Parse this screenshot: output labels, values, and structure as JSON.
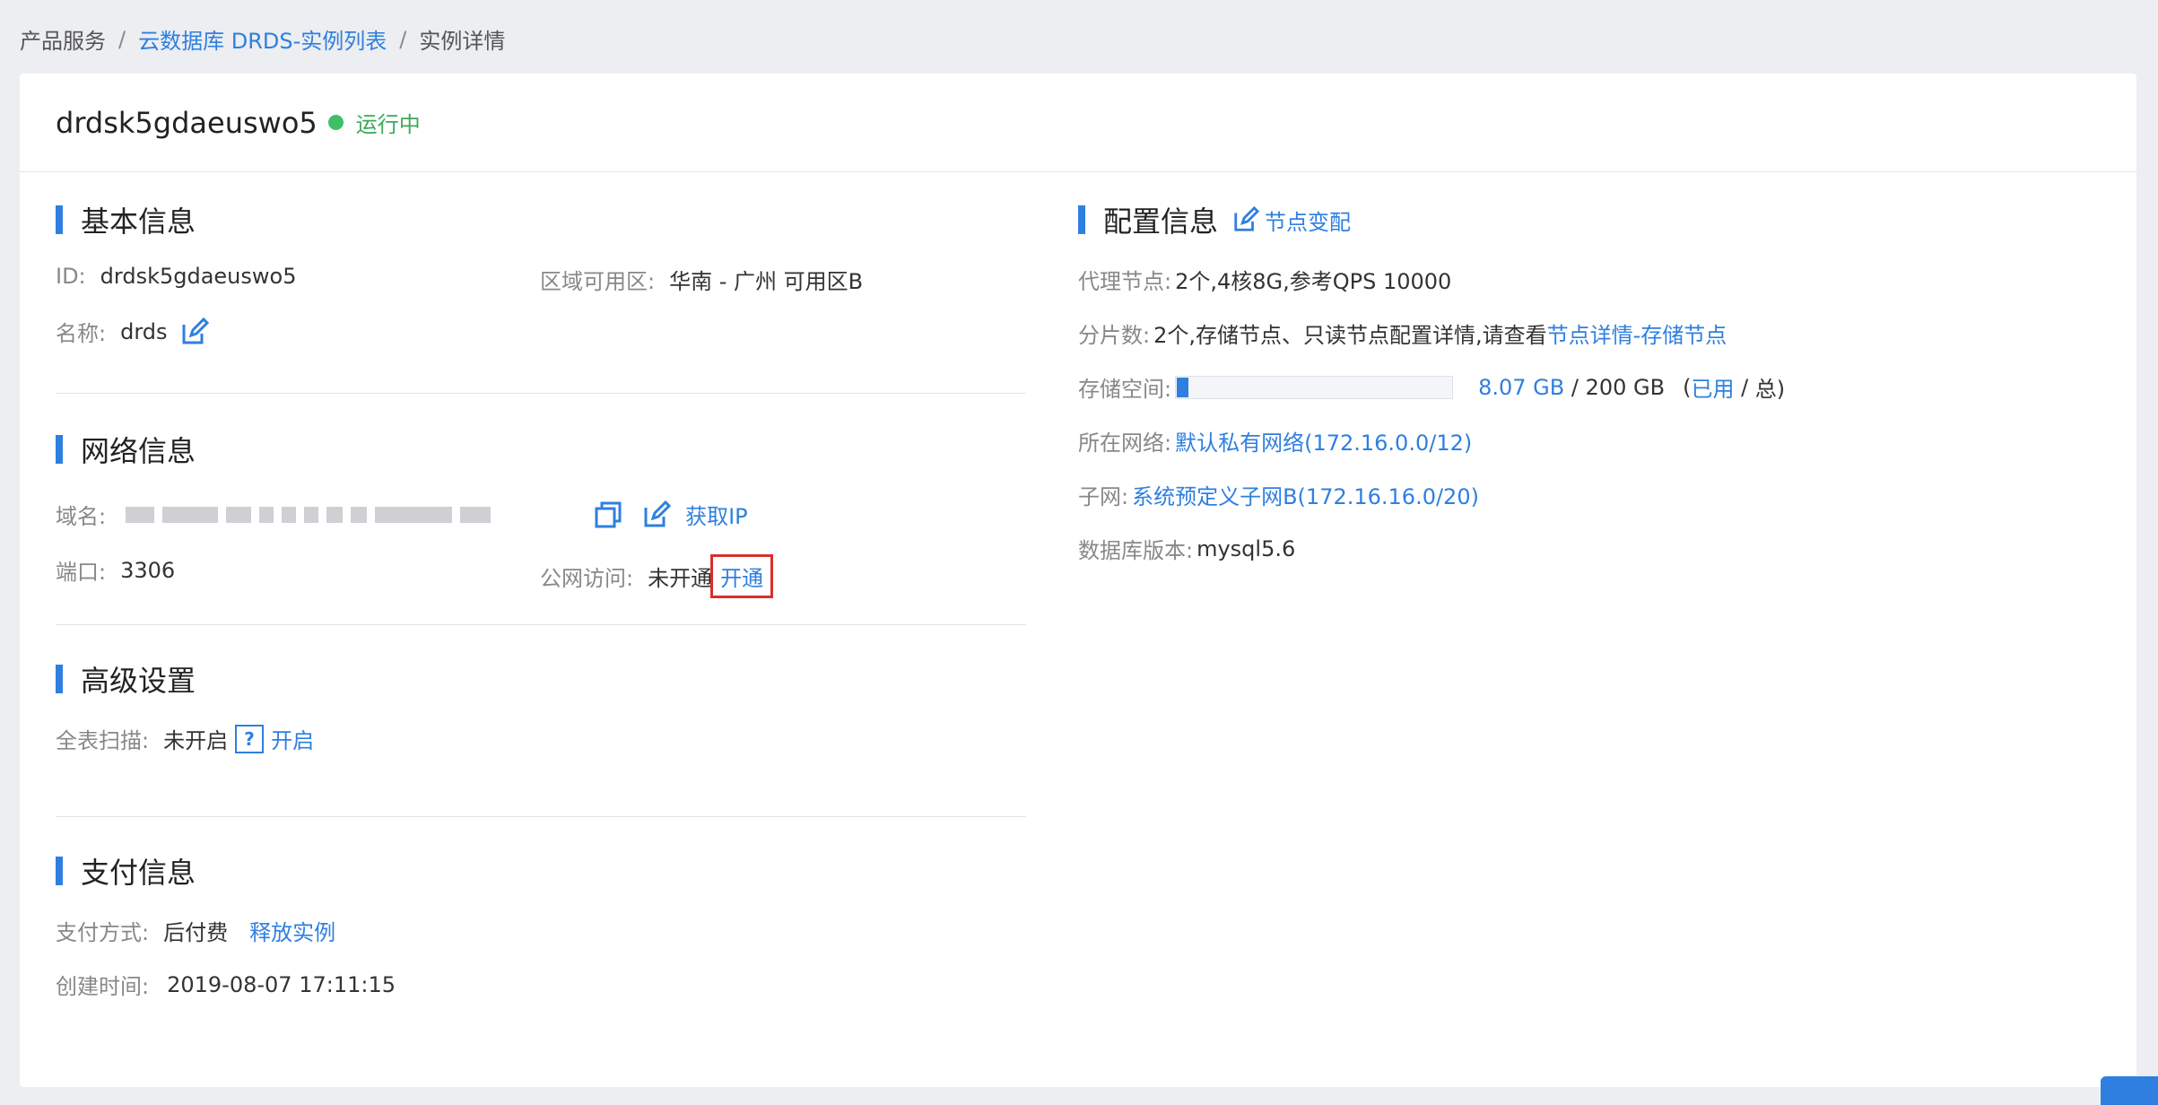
{
  "breadcrumb": {
    "item1": "产品服务",
    "item2": "云数据库 DRDS-实例列表",
    "item3": "实例详情",
    "separator": "/"
  },
  "header": {
    "instance_name": "drdsk5gdaeuswo5",
    "status": "运行中",
    "status_color": "#3fbf67"
  },
  "basic": {
    "title": "基本信息",
    "id_label": "ID:",
    "id_value": "drdsk5gdaeuswo5",
    "region_label": "区域可用区:",
    "region_value": "华南 - 广州 可用区B",
    "name_label": "名称:",
    "name_value": "drds"
  },
  "network": {
    "title": "网络信息",
    "domain_label": "域名:",
    "get_ip": "获取IP",
    "port_label": "端口:",
    "port_value": "3306",
    "public_label": "公网访问:",
    "public_value": "未开通",
    "public_action": "开通"
  },
  "advanced": {
    "title": "高级设置",
    "scan_label": "全表扫描:",
    "scan_value": "未开启",
    "help": "?",
    "scan_action": "开启"
  },
  "payment": {
    "title": "支付信息",
    "method_label": "支付方式:",
    "method_value": "后付费",
    "release": "释放实例",
    "created_label": "创建时间:",
    "created_value": "2019-08-07 17:11:15"
  },
  "config": {
    "title": "配置信息",
    "change_link": "节点变配",
    "proxy_label": "代理节点:",
    "proxy_value": "2个,4核8G,参考QPS 10000",
    "shard_label": "分片数:",
    "shard_value": "2个,存储节点、只读节点配置详情,请查看",
    "shard_link": "节点详情-存储节点",
    "storage_label": "存储空间:",
    "storage_used": "8.07 GB",
    "storage_sep": " / ",
    "storage_total": "200 GB",
    "storage_paren_open": "(",
    "storage_used_label": "已用",
    "storage_total_label": "总)",
    "storage_fraction": 0.0404,
    "network_label": "所在网络:",
    "network_value": "默认私有网络(172.16.0.0/12)",
    "subnet_label": "子网:",
    "subnet_value": "系统预定义子网B(172.16.16.0/20)",
    "db_label": "数据库版本:",
    "db_value": "mysql5.6"
  },
  "accent_color": "#2f7fe0"
}
